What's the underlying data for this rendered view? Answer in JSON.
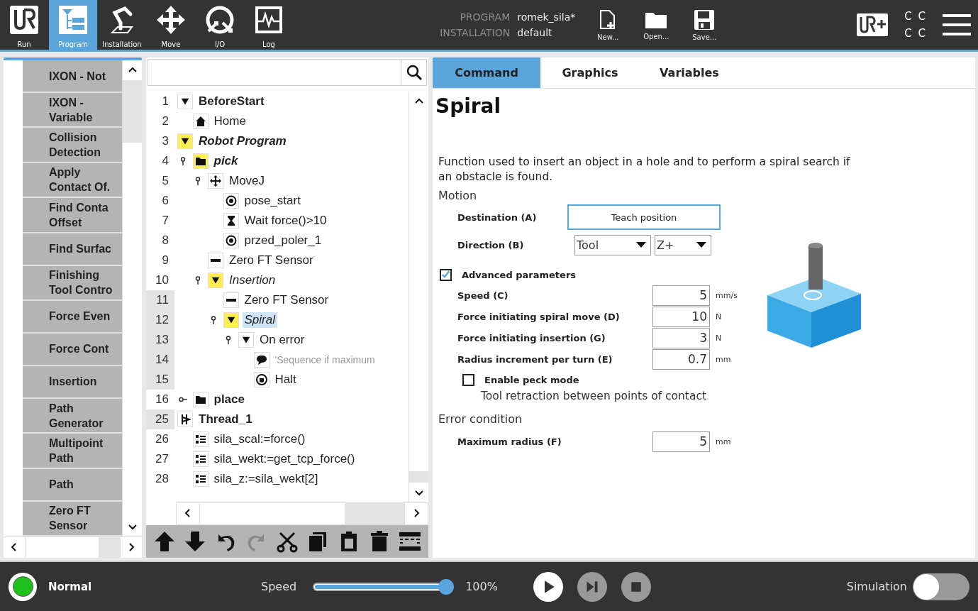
{
  "nav": [
    {
      "label": "Run",
      "selected": false
    },
    {
      "label": "Program",
      "selected": true
    },
    {
      "label": "Installation",
      "selected": false
    },
    {
      "label": "Move",
      "selected": false
    },
    {
      "label": "I/O",
      "selected": false
    },
    {
      "label": "Log",
      "selected": false
    }
  ],
  "header": {
    "program_label": "PROGRAM",
    "program": "romek_sila*",
    "installation_label": "INSTALLATION",
    "installation": "default"
  },
  "file_buttons": [
    "New...",
    "Open...",
    "Save..."
  ],
  "corner_text": [
    "C C",
    "C C"
  ],
  "nodes_panel": {
    "items": [
      {
        "lines": [
          "IXON - Not"
        ]
      },
      {
        "lines": [
          "IXON -",
          "Variable"
        ]
      },
      {
        "lines": [
          "Collision",
          "Detection"
        ]
      },
      {
        "lines": [
          "Apply",
          "Contact Of."
        ]
      },
      {
        "lines": [
          "Find Conta",
          "Offset"
        ]
      },
      {
        "lines": [
          "Find Surfac"
        ]
      },
      {
        "lines": [
          "Finishing",
          "Tool Contro"
        ]
      },
      {
        "lines": [
          "Force Even"
        ]
      },
      {
        "lines": [
          "Force Cont"
        ]
      },
      {
        "lines": [
          "Insertion"
        ]
      },
      {
        "lines": [
          "Path",
          "Generator"
        ]
      },
      {
        "lines": [
          "Multipoint",
          "Path"
        ]
      },
      {
        "lines": [
          "Path"
        ]
      },
      {
        "lines": [
          "Zero FT",
          "Sensor"
        ]
      }
    ]
  },
  "tree": [
    {
      "line": "1",
      "label": "BeforeStart",
      "kind": "toggle",
      "bold": true,
      "italic": false,
      "highlighted": false,
      "selected": false,
      "shaded": false,
      "expanded": true,
      "children": [
        {
          "line": "2",
          "label": "Home",
          "kind": "home",
          "bold": false,
          "italic": false,
          "highlighted": false,
          "selected": false,
          "shaded": false
        }
      ]
    },
    {
      "line": "3",
      "label": "Robot Program",
      "kind": "toggle",
      "bold": true,
      "italic": true,
      "highlighted": true,
      "selected": false,
      "shaded": false,
      "expanded": true,
      "children": [
        {
          "line": "4",
          "label": "pick",
          "kind": "folder",
          "bold": true,
          "italic": true,
          "highlighted": true,
          "selected": false,
          "shaded": false,
          "expanded": true,
          "children": [
            {
              "line": "5",
              "label": "MoveJ",
              "kind": "move",
              "bold": false,
              "italic": false,
              "highlighted": false,
              "selected": false,
              "shaded": false,
              "expanded": true,
              "children": [
                {
                  "line": "6",
                  "label": "pose_start",
                  "kind": "waypoint",
                  "bold": false,
                  "italic": false,
                  "highlighted": false,
                  "selected": false,
                  "shaded": false
                },
                {
                  "line": "7",
                  "label": "Wait force()>10",
                  "kind": "wait",
                  "bold": false,
                  "italic": false,
                  "highlighted": false,
                  "selected": false,
                  "shaded": false
                },
                {
                  "line": "8",
                  "label": "przed_poler_1",
                  "kind": "waypoint",
                  "bold": false,
                  "italic": false,
                  "highlighted": false,
                  "selected": false,
                  "shaded": false
                }
              ]
            },
            {
              "line": "9",
              "label": "Zero FT Sensor",
              "kind": "zero",
              "bold": false,
              "italic": false,
              "highlighted": false,
              "selected": false,
              "shaded": false
            },
            {
              "line": "10",
              "label": "Insertion",
              "kind": "toggle",
              "bold": false,
              "italic": true,
              "highlighted": true,
              "selected": false,
              "shaded": false,
              "expanded": true,
              "children": [
                {
                  "line": "11",
                  "label": "Zero FT Sensor",
                  "kind": "zero",
                  "bold": false,
                  "italic": false,
                  "highlighted": false,
                  "selected": false,
                  "shaded": true
                },
                {
                  "line": "12",
                  "label": "Spiral",
                  "kind": "toggle",
                  "bold": false,
                  "italic": true,
                  "highlighted": true,
                  "selected": true,
                  "shaded": true,
                  "expanded": true,
                  "children": [
                    {
                      "line": "13",
                      "label": "On error",
                      "kind": "toggle",
                      "bold": false,
                      "italic": false,
                      "highlighted": false,
                      "selected": false,
                      "shaded": true,
                      "expanded": true,
                      "children": [
                        {
                          "line": "14",
                          "label": "'Sequence if maximum",
                          "kind": "comment",
                          "bold": false,
                          "italic": false,
                          "highlighted": false,
                          "selected": false,
                          "shaded": true
                        },
                        {
                          "line": "15",
                          "label": "Halt",
                          "kind": "halt",
                          "bold": false,
                          "italic": false,
                          "highlighted": false,
                          "selected": false,
                          "shaded": true
                        }
                      ]
                    }
                  ]
                }
              ]
            }
          ]
        },
        {
          "line": "16",
          "label": "place",
          "kind": "folder",
          "bold": true,
          "italic": false,
          "highlighted": false,
          "selected": false,
          "shaded": false,
          "expanded": false
        }
      ]
    },
    {
      "line": "25",
      "label": "Thread_1",
      "kind": "thread",
      "bold": true,
      "italic": false,
      "highlighted": false,
      "selected": false,
      "shaded": true,
      "expanded": true,
      "children": [
        {
          "line": "26",
          "label": "sila_scal:=force()",
          "kind": "assign",
          "bold": false,
          "italic": false,
          "highlighted": false,
          "selected": false,
          "shaded": false
        },
        {
          "line": "27",
          "label": "sila_wekt:=get_tcp_force()",
          "kind": "assign",
          "bold": false,
          "italic": false,
          "highlighted": false,
          "selected": false,
          "shaded": false
        },
        {
          "line": "28",
          "label": "sila_z:=sila_wekt[2]",
          "kind": "assign",
          "bold": false,
          "italic": false,
          "highlighted": false,
          "selected": false,
          "shaded": false
        }
      ]
    }
  ],
  "tree_toolbar": [
    {
      "disabled": false
    },
    {
      "disabled": false
    },
    {
      "disabled": false
    },
    {
      "disabled": true
    },
    {
      "disabled": false
    },
    {
      "disabled": false
    },
    {
      "disabled": false
    },
    {
      "disabled": false
    },
    {
      "disabled": false
    }
  ],
  "tabs": [
    {
      "label": "Command",
      "selected": true
    },
    {
      "label": "Graphics",
      "selected": false
    },
    {
      "label": "Variables",
      "selected": false
    }
  ],
  "command": {
    "title": "Spiral",
    "description": "Function used to insert an object in a hole and to perform a spiral search if an obstacle is found.",
    "motion_label": "Motion",
    "destination": {
      "label": "Destination (A)",
      "button": "Teach position"
    },
    "direction": {
      "label": "Direction (B)",
      "frame": "Tool",
      "axis": "Z+"
    },
    "advanced": {
      "label": "Advanced parameters",
      "checked": true
    },
    "params": [
      {
        "label": "Speed (C)",
        "value": "5",
        "unit": "mm/s"
      },
      {
        "label": "Force initiating spiral move (D)",
        "value": "10",
        "unit": "N"
      },
      {
        "label": "Force initiating insertion (G)",
        "value": "3",
        "unit": "N"
      },
      {
        "label": "Radius increment per turn (E)",
        "value": "0.7",
        "unit": "mm"
      }
    ],
    "peck": {
      "label": "Enable peck mode",
      "checked": false,
      "note": "Tool retraction between points of contact"
    },
    "error_label": "Error condition",
    "max_radius": {
      "label": "Maximum radius (F)",
      "value": "5",
      "unit": "mm"
    }
  },
  "footer": {
    "status": "Normal",
    "speed_label": "Speed",
    "speed": {
      "level": 1.0
    },
    "speed_reading": "100%",
    "controls": [
      {
        "kind": "play",
        "disabled": false
      },
      {
        "kind": "step",
        "disabled": true
      },
      {
        "kind": "stop",
        "disabled": true
      }
    ],
    "simulation_label": "Simulation",
    "simulation": {
      "on": false
    }
  }
}
